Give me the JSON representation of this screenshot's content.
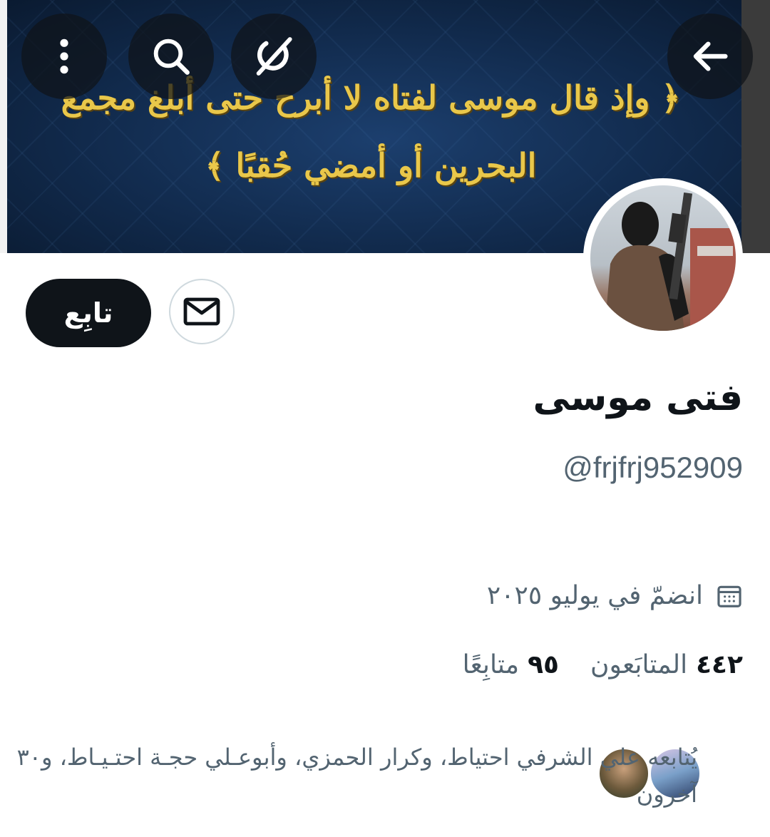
{
  "banner": {
    "verse_line_1": "﴿ وإذ قال موسى لفتاه لا أبرح حتى أبلغ مجمع",
    "verse_line_2": "البحرين أو أمضي حُقبًا ﴾"
  },
  "nav": {
    "back_icon": "arrow-left-icon",
    "grok_icon": "grok-icon",
    "search_icon": "search-icon",
    "more_icon": "more-vertical-icon"
  },
  "profile": {
    "display_name": "فتى موسى",
    "handle": "@frjfrj952909",
    "follow_label": "تابِع",
    "joined": "انضمّ في يوليو ٢٠٢٥",
    "followers_count": "٤٤٢",
    "followers_label": "المتابَعون",
    "following_count": "٩٥",
    "following_label": "متابِعًا",
    "followed_by": "يُتابعه علي الشرفي احتياط، وكرار الحمزي، وأبوعـلي حجـة احتـيـاط، و٣٠ آخرون"
  },
  "colors": {
    "primary_text": "#0f1419",
    "secondary_text": "#536471",
    "banner_bg": "#112a4c",
    "verse_gold": "#e9c74a"
  }
}
